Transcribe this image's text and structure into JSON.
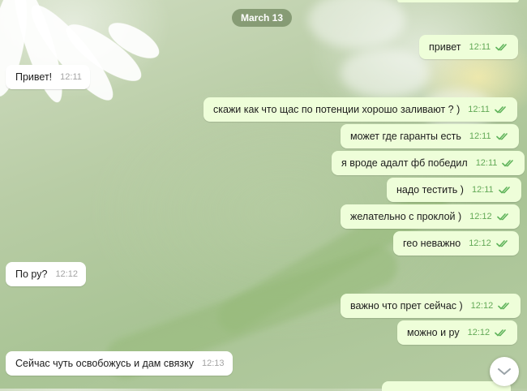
{
  "chat": {
    "date": "March 13",
    "messages": [
      {
        "dir": "out",
        "text": "привет",
        "time": "12:11"
      },
      {
        "dir": "in",
        "text": "Привет!",
        "time": "12:11"
      },
      {
        "dir": "out",
        "text": "скажи как что щас по потенции хорошо заливают ? )",
        "time": "12:11"
      },
      {
        "dir": "out",
        "text": "может где гаранты есть",
        "time": "12:11"
      },
      {
        "dir": "out",
        "text": "я вроде адалт фб победил",
        "time": "12:11"
      },
      {
        "dir": "out",
        "text": "надо тестить )",
        "time": "12:11"
      },
      {
        "dir": "out",
        "text": "желательно с проклой )",
        "time": "12:12"
      },
      {
        "dir": "out",
        "text": "гео неважно",
        "time": "12:12"
      },
      {
        "dir": "in",
        "text": "По ру?",
        "time": "12:12"
      },
      {
        "dir": "out",
        "text": "важно что прет сейчас )",
        "time": "12:12"
      },
      {
        "dir": "out",
        "text": "можно и ру",
        "time": "12:12"
      },
      {
        "dir": "in",
        "text": "Сейчас чуть освобожусь и дам связку",
        "time": "12:13"
      }
    ]
  },
  "icons": {
    "read_check": "double-check-icon",
    "scroll_down": "chevron-down-icon"
  },
  "colors": {
    "outgoing_bubble": "#eefed9",
    "incoming_bubble": "#ffffff",
    "check": "#5fb35a"
  }
}
